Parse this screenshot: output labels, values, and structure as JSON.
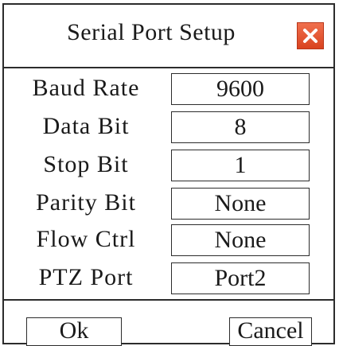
{
  "dialog": {
    "title": "Serial Port Setup",
    "close_icon": "close-icon",
    "accent": "#e2532f"
  },
  "fields": [
    {
      "label": "Baud Rate",
      "value": "9600"
    },
    {
      "label": "Data Bit",
      "value": "8"
    },
    {
      "label": "Stop Bit",
      "value": "1"
    },
    {
      "label": "Parity Bit",
      "value": "None"
    },
    {
      "label": "Flow Ctrl",
      "value": "None"
    },
    {
      "label": "PTZ Port",
      "value": "Port2"
    }
  ],
  "buttons": {
    "ok": "Ok",
    "cancel": "Cancel"
  }
}
